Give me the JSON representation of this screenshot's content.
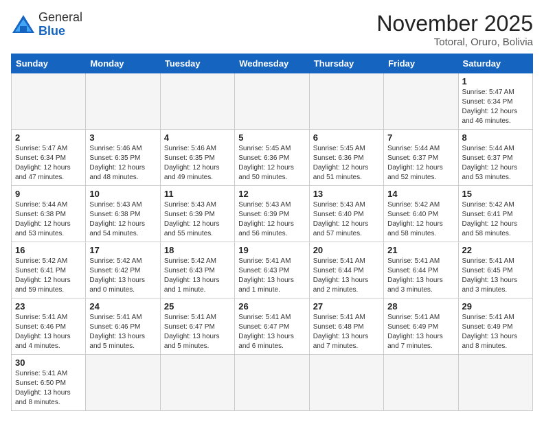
{
  "header": {
    "title": "November 2025",
    "subtitle": "Totoral, Oruro, Bolivia",
    "logo_general": "General",
    "logo_blue": "Blue"
  },
  "weekdays": [
    "Sunday",
    "Monday",
    "Tuesday",
    "Wednesday",
    "Thursday",
    "Friday",
    "Saturday"
  ],
  "weeks": [
    [
      {
        "day": "",
        "info": ""
      },
      {
        "day": "",
        "info": ""
      },
      {
        "day": "",
        "info": ""
      },
      {
        "day": "",
        "info": ""
      },
      {
        "day": "",
        "info": ""
      },
      {
        "day": "",
        "info": ""
      },
      {
        "day": "1",
        "info": "Sunrise: 5:47 AM\nSunset: 6:34 PM\nDaylight: 12 hours\nand 46 minutes."
      }
    ],
    [
      {
        "day": "2",
        "info": "Sunrise: 5:47 AM\nSunset: 6:34 PM\nDaylight: 12 hours\nand 47 minutes."
      },
      {
        "day": "3",
        "info": "Sunrise: 5:46 AM\nSunset: 6:35 PM\nDaylight: 12 hours\nand 48 minutes."
      },
      {
        "day": "4",
        "info": "Sunrise: 5:46 AM\nSunset: 6:35 PM\nDaylight: 12 hours\nand 49 minutes."
      },
      {
        "day": "5",
        "info": "Sunrise: 5:45 AM\nSunset: 6:36 PM\nDaylight: 12 hours\nand 50 minutes."
      },
      {
        "day": "6",
        "info": "Sunrise: 5:45 AM\nSunset: 6:36 PM\nDaylight: 12 hours\nand 51 minutes."
      },
      {
        "day": "7",
        "info": "Sunrise: 5:44 AM\nSunset: 6:37 PM\nDaylight: 12 hours\nand 52 minutes."
      },
      {
        "day": "8",
        "info": "Sunrise: 5:44 AM\nSunset: 6:37 PM\nDaylight: 12 hours\nand 53 minutes."
      }
    ],
    [
      {
        "day": "9",
        "info": "Sunrise: 5:44 AM\nSunset: 6:38 PM\nDaylight: 12 hours\nand 53 minutes."
      },
      {
        "day": "10",
        "info": "Sunrise: 5:43 AM\nSunset: 6:38 PM\nDaylight: 12 hours\nand 54 minutes."
      },
      {
        "day": "11",
        "info": "Sunrise: 5:43 AM\nSunset: 6:39 PM\nDaylight: 12 hours\nand 55 minutes."
      },
      {
        "day": "12",
        "info": "Sunrise: 5:43 AM\nSunset: 6:39 PM\nDaylight: 12 hours\nand 56 minutes."
      },
      {
        "day": "13",
        "info": "Sunrise: 5:43 AM\nSunset: 6:40 PM\nDaylight: 12 hours\nand 57 minutes."
      },
      {
        "day": "14",
        "info": "Sunrise: 5:42 AM\nSunset: 6:40 PM\nDaylight: 12 hours\nand 58 minutes."
      },
      {
        "day": "15",
        "info": "Sunrise: 5:42 AM\nSunset: 6:41 PM\nDaylight: 12 hours\nand 58 minutes."
      }
    ],
    [
      {
        "day": "16",
        "info": "Sunrise: 5:42 AM\nSunset: 6:41 PM\nDaylight: 12 hours\nand 59 minutes."
      },
      {
        "day": "17",
        "info": "Sunrise: 5:42 AM\nSunset: 6:42 PM\nDaylight: 13 hours\nand 0 minutes."
      },
      {
        "day": "18",
        "info": "Sunrise: 5:42 AM\nSunset: 6:43 PM\nDaylight: 13 hours\nand 1 minute."
      },
      {
        "day": "19",
        "info": "Sunrise: 5:41 AM\nSunset: 6:43 PM\nDaylight: 13 hours\nand 1 minute."
      },
      {
        "day": "20",
        "info": "Sunrise: 5:41 AM\nSunset: 6:44 PM\nDaylight: 13 hours\nand 2 minutes."
      },
      {
        "day": "21",
        "info": "Sunrise: 5:41 AM\nSunset: 6:44 PM\nDaylight: 13 hours\nand 3 minutes."
      },
      {
        "day": "22",
        "info": "Sunrise: 5:41 AM\nSunset: 6:45 PM\nDaylight: 13 hours\nand 3 minutes."
      }
    ],
    [
      {
        "day": "23",
        "info": "Sunrise: 5:41 AM\nSunset: 6:46 PM\nDaylight: 13 hours\nand 4 minutes."
      },
      {
        "day": "24",
        "info": "Sunrise: 5:41 AM\nSunset: 6:46 PM\nDaylight: 13 hours\nand 5 minutes."
      },
      {
        "day": "25",
        "info": "Sunrise: 5:41 AM\nSunset: 6:47 PM\nDaylight: 13 hours\nand 5 minutes."
      },
      {
        "day": "26",
        "info": "Sunrise: 5:41 AM\nSunset: 6:47 PM\nDaylight: 13 hours\nand 6 minutes."
      },
      {
        "day": "27",
        "info": "Sunrise: 5:41 AM\nSunset: 6:48 PM\nDaylight: 13 hours\nand 7 minutes."
      },
      {
        "day": "28",
        "info": "Sunrise: 5:41 AM\nSunset: 6:49 PM\nDaylight: 13 hours\nand 7 minutes."
      },
      {
        "day": "29",
        "info": "Sunrise: 5:41 AM\nSunset: 6:49 PM\nDaylight: 13 hours\nand 8 minutes."
      }
    ],
    [
      {
        "day": "30",
        "info": "Sunrise: 5:41 AM\nSunset: 6:50 PM\nDaylight: 13 hours\nand 8 minutes."
      },
      {
        "day": "",
        "info": ""
      },
      {
        "day": "",
        "info": ""
      },
      {
        "day": "",
        "info": ""
      },
      {
        "day": "",
        "info": ""
      },
      {
        "day": "",
        "info": ""
      },
      {
        "day": "",
        "info": ""
      }
    ]
  ]
}
